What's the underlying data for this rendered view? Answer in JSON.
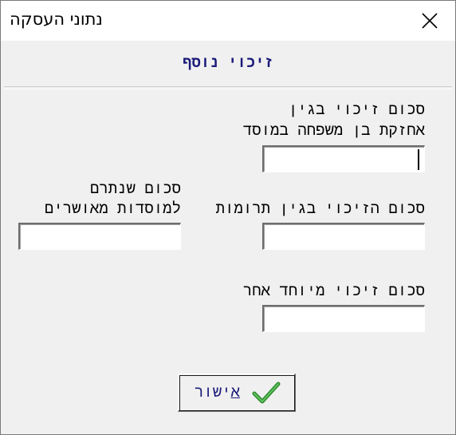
{
  "window": {
    "title": "נתוני העסקה",
    "close_label": "✕"
  },
  "header": {
    "title": "זיכוי נוסף"
  },
  "form": {
    "field1": {
      "label_line1": "סכום זיכוי בגין",
      "label_line2": "אחזקת בן משפחה במוסד",
      "value": ""
    },
    "field2": {
      "label": "סכום הזיכוי בגין תרומות",
      "value": ""
    },
    "field3": {
      "label_line1": "סכום שנתרם",
      "label_line2": "למוסדות מאושרים",
      "value": ""
    },
    "field4": {
      "label": "סכום זיכוי מיוחד  אחר",
      "value": ""
    }
  },
  "ok_button": {
    "label_underlined": "א",
    "label_rest": "ישור",
    "icon": "checkmark-icon",
    "icon_color": "#2e8b2e"
  }
}
